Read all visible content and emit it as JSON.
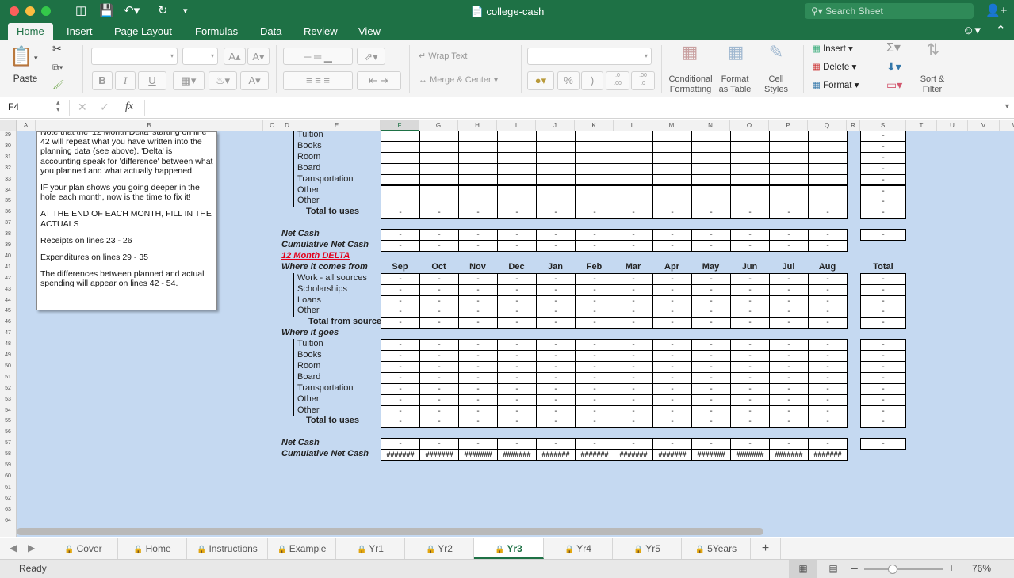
{
  "window": {
    "title": "college-cash",
    "search_placeholder": "Search Sheet",
    "traffic_colors": [
      "#fc605b",
      "#fdbc40",
      "#34c84a"
    ]
  },
  "ribbon_tabs": [
    "Home",
    "Insert",
    "Page Layout",
    "Formulas",
    "Data",
    "Review",
    "View"
  ],
  "ribbon": {
    "paste": "Paste",
    "wrap_text": "Wrap Text",
    "merge_center": "Merge & Center",
    "conditional_formatting": [
      "Conditional",
      "Formatting"
    ],
    "format_as_table": [
      "Format",
      "as Table"
    ],
    "cell_styles": [
      "Cell",
      "Styles"
    ],
    "insert": "Insert",
    "delete": "Delete",
    "format": "Format",
    "sort_filter": [
      "Sort &",
      "Filter"
    ],
    "bold": "B",
    "italic": "I",
    "underline": "U",
    "percent": "%",
    "comma": ")",
    "font_grow": "A▴",
    "font_shrink": "A▾",
    "font_color": "A",
    "dec_inc": ".0\n.00",
    "dec_dec": ".00\n.0"
  },
  "formula_bar": {
    "cell_ref": "F4",
    "fx": "fx",
    "cancel": "✕",
    "confirm": "✓",
    "value": ""
  },
  "columns": [
    {
      "id": "A",
      "w": 24
    },
    {
      "id": "B",
      "w": 287
    },
    {
      "id": "C",
      "w": 23
    },
    {
      "id": "D",
      "w": 15
    },
    {
      "id": "E",
      "w": 110
    },
    {
      "id": "F",
      "w": 49
    },
    {
      "id": "G",
      "w": 49
    },
    {
      "id": "H",
      "w": 49
    },
    {
      "id": "I",
      "w": 49
    },
    {
      "id": "J",
      "w": 49
    },
    {
      "id": "K",
      "w": 49
    },
    {
      "id": "L",
      "w": 49
    },
    {
      "id": "M",
      "w": 49
    },
    {
      "id": "N",
      "w": 49
    },
    {
      "id": "O",
      "w": 49
    },
    {
      "id": "P",
      "w": 49
    },
    {
      "id": "Q",
      "w": 49
    },
    {
      "id": "R",
      "w": 17
    },
    {
      "id": "S",
      "w": 58
    },
    {
      "id": "T",
      "w": 39
    },
    {
      "id": "U",
      "w": 39
    },
    {
      "id": "V",
      "w": 40
    },
    {
      "id": "W",
      "w": 40
    }
  ],
  "row_numbers": [
    "29",
    "30",
    "31",
    "32",
    "33",
    "34",
    "35",
    "36",
    "37",
    "38",
    "39",
    "40",
    "41",
    "42",
    "43",
    "44",
    "45",
    "46",
    "47",
    "48",
    "49",
    "50",
    "51",
    "52",
    "53",
    "54",
    "55",
    "56",
    "57",
    "58",
    "59",
    "60",
    "61",
    "62",
    "63",
    "64"
  ],
  "note": [
    "Note that the '12 Month Delta' starting on line 42 will repeat what you have written into the planning data (see above). 'Delta' is accounting speak for 'difference' between what you planned and what actually happened.",
    "IF your plan shows you going deeper in the hole each month, now is the time to fix it!",
    "AT THE END OF EACH MONTH, FILL IN THE ACTUALS",
    "Receipts on lines 23 - 26",
    "Expenditures on lines 29 - 35",
    "The differences between planned and actual spending will appear on lines 42 - 54."
  ],
  "months": [
    "Sep",
    "Oct",
    "Nov",
    "Dec",
    "Jan",
    "Feb",
    "Mar",
    "Apr",
    "May",
    "Jun",
    "Jul",
    "Aug"
  ],
  "total_header": "Total",
  "dash": "-",
  "hash": "#######",
  "grid_rows": [
    {
      "row": "29",
      "label": "Tuition",
      "kind": "input"
    },
    {
      "row": "30",
      "label": "Books",
      "kind": "input"
    },
    {
      "row": "31",
      "label": "Room",
      "kind": "input"
    },
    {
      "row": "32",
      "label": "Board",
      "kind": "input"
    },
    {
      "row": "33",
      "label": "Transportation",
      "kind": "input"
    },
    {
      "row": "34",
      "label": "Other",
      "kind": "input"
    },
    {
      "row": "35",
      "label": "Other",
      "kind": "input"
    },
    {
      "row": "36",
      "label": "Total to uses",
      "kind": "total"
    },
    {
      "row": "38",
      "label": "Net Cash",
      "kind": "net"
    },
    {
      "row": "39",
      "label": "Cumulative Net Cash",
      "kind": "cum"
    },
    {
      "row": "40",
      "label": "12 Month DELTA",
      "kind": "title"
    },
    {
      "row": "41",
      "label": "Where it comes from",
      "kind": "months"
    },
    {
      "row": "42",
      "label": "Work - all sources",
      "kind": "item"
    },
    {
      "row": "43",
      "label": "Scholarships",
      "kind": "item"
    },
    {
      "row": "44",
      "label": "Loans",
      "kind": "item"
    },
    {
      "row": "45",
      "label": "Other",
      "kind": "item"
    },
    {
      "row": "46",
      "label": "Total from sources",
      "kind": "total2"
    },
    {
      "row": "47",
      "label": "Where it goes",
      "kind": "section"
    },
    {
      "row": "48",
      "label": "Tuition",
      "kind": "item"
    },
    {
      "row": "49",
      "label": "Books",
      "kind": "item"
    },
    {
      "row": "50",
      "label": "Room",
      "kind": "item"
    },
    {
      "row": "51",
      "label": "Board",
      "kind": "item"
    },
    {
      "row": "52",
      "label": "Transportation",
      "kind": "item"
    },
    {
      "row": "53",
      "label": "Other",
      "kind": "item"
    },
    {
      "row": "54",
      "label": "Other",
      "kind": "item"
    },
    {
      "row": "55",
      "label": "Total to uses",
      "kind": "total"
    },
    {
      "row": "57",
      "label": "Net Cash",
      "kind": "net"
    },
    {
      "row": "58",
      "label": "Cumulative Net Cash",
      "kind": "cumhash"
    }
  ],
  "sheet_tabs": [
    {
      "label": "Cover",
      "active": false
    },
    {
      "label": "Home",
      "active": false
    },
    {
      "label": "Instructions",
      "active": false
    },
    {
      "label": "Example",
      "active": false
    },
    {
      "label": "Yr1",
      "active": false
    },
    {
      "label": "Yr2",
      "active": false
    },
    {
      "label": "Yr3",
      "active": true
    },
    {
      "label": "Yr4",
      "active": false
    },
    {
      "label": "Yr5",
      "active": false
    },
    {
      "label": "5Years",
      "active": false
    }
  ],
  "add_sheet": "+",
  "status": {
    "text": "Ready",
    "zoom": "76%",
    "zoom_level": 0.76
  },
  "colors": {
    "accent": "#1e7145",
    "grid_fill": "#c5d9f1",
    "delta_red": "#e3001b"
  }
}
